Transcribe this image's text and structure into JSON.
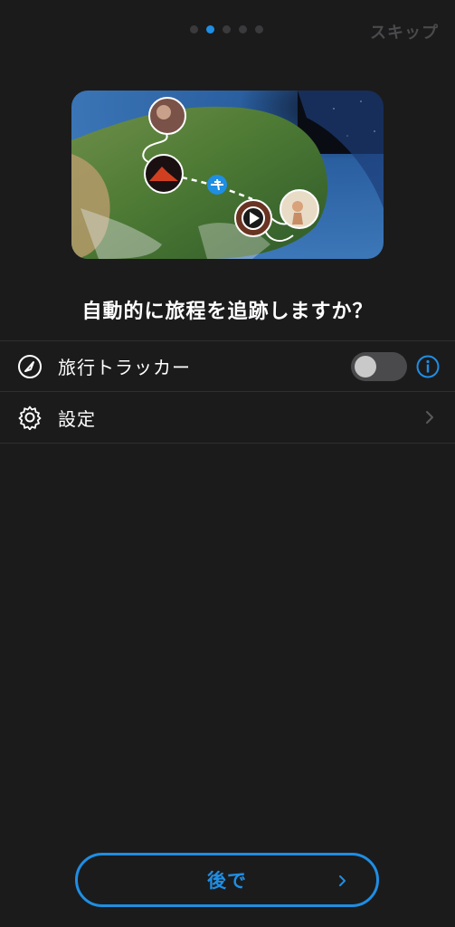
{
  "pager": {
    "total": 5,
    "active_index": 1
  },
  "header": {
    "skip_label": "スキップ"
  },
  "hero": {
    "icons": [
      "earth-map-image",
      "person-photo-icon",
      "volcano-photo-icon",
      "airplane-icon",
      "play-video-icon",
      "beach-photo-icon"
    ]
  },
  "question": "自動的に旅程を追跡しますか？",
  "tracker_row": {
    "label": "旅行トラッカー",
    "toggle_on": false,
    "icon": "compass-icon",
    "info_icon": "info-icon"
  },
  "settings_row": {
    "label": "設定",
    "icon": "gear-icon"
  },
  "footer": {
    "later_label": "後で"
  },
  "colors": {
    "accent": "#1f8ee3",
    "background": "#1b1b1c",
    "divider": "#2f2f31"
  }
}
